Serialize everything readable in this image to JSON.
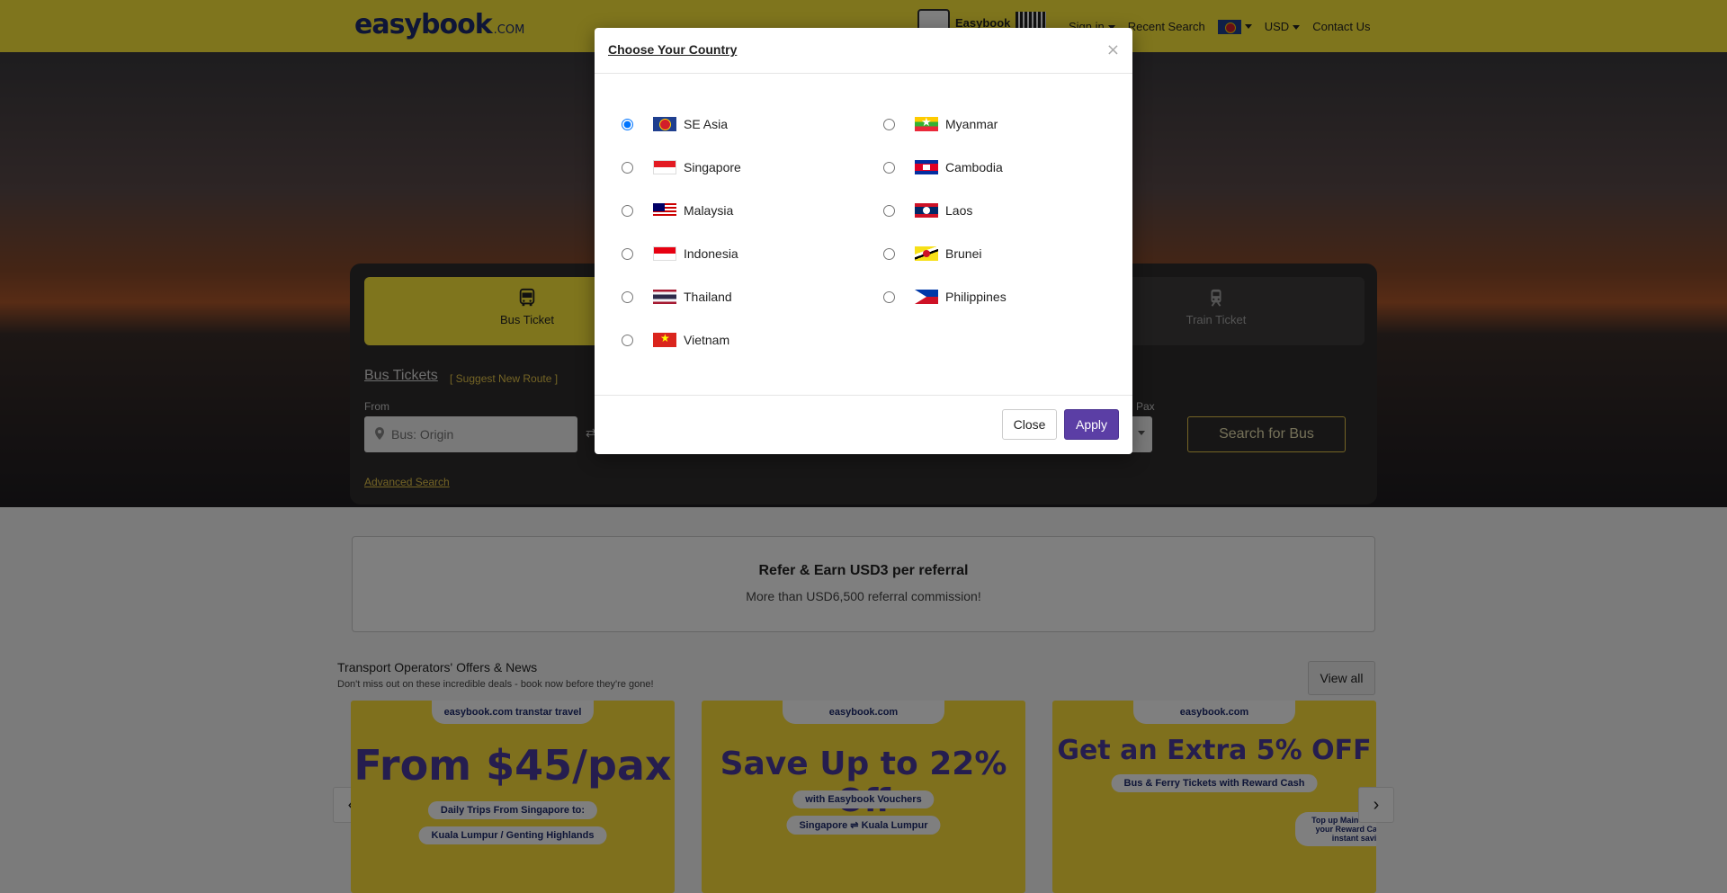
{
  "header": {
    "logo": "easybook",
    "logo_suffix": ".COM",
    "app_label": "Easybook",
    "nav": {
      "sign_in": "Sign in",
      "recent_search": "Recent Search",
      "currency": "USD",
      "contact": "Contact Us"
    }
  },
  "search": {
    "tabs": [
      {
        "label": "Bus Ticket",
        "icon": "bus-icon",
        "active": true
      },
      {
        "label": "Train Ticket",
        "icon": "train-icon",
        "active": false
      }
    ],
    "title": "Bus Tickets",
    "suggest": "[ Suggest New Route ]",
    "from_label": "From",
    "from_placeholder": "Bus: Origin",
    "pax_label": "Pax",
    "search_button": "Search for Bus",
    "advanced": "Advanced Search"
  },
  "referral": {
    "title": "Refer & Earn USD3 per referral",
    "subtitle": "More than USD6,500 referral commission!"
  },
  "offers": {
    "title": "Transport Operators' Offers & News",
    "subtitle": "Don't miss out on these incredible deals - book now before they're gone!",
    "view_all": "View all",
    "cards": [
      {
        "brand": "easybook.com  transtar travel",
        "headline": "From $45/pax",
        "sub": "Daily Trips From Singapore to:",
        "sub2": "Kuala Lumpur / Genting Highlands"
      },
      {
        "brand": "easybook.com",
        "headline": "Save Up to 22% Off",
        "sub": "with Easybook Vouchers",
        "sub2": "Singapore ⇌ Kuala Lumpur"
      },
      {
        "brand": "easybook.com",
        "headline": "Get an Extra 5% OFF",
        "sub": "Bus & Ferry Tickets with Reward Cash",
        "sub2": "Top up Main Cash, redeem your Reward Cash enjoy instant savings!"
      }
    ]
  },
  "modal": {
    "title": "Choose Your Country",
    "close_x": "×",
    "selected": "SE Asia",
    "left": [
      {
        "label": "SE Asia",
        "flag": "asean-flag-icon"
      },
      {
        "label": "Singapore",
        "flag": "singapore-flag-icon"
      },
      {
        "label": "Malaysia",
        "flag": "malaysia-flag-icon"
      },
      {
        "label": "Indonesia",
        "flag": "indonesia-flag-icon"
      },
      {
        "label": "Thailand",
        "flag": "thailand-flag-icon"
      },
      {
        "label": "Vietnam",
        "flag": "vietnam-flag-icon"
      }
    ],
    "right": [
      {
        "label": "Myanmar",
        "flag": "myanmar-flag-icon"
      },
      {
        "label": "Cambodia",
        "flag": "cambodia-flag-icon"
      },
      {
        "label": "Laos",
        "flag": "laos-flag-icon"
      },
      {
        "label": "Brunei",
        "flag": "brunei-flag-icon"
      },
      {
        "label": "Philippines",
        "flag": "philippines-flag-icon"
      }
    ],
    "close_button": "Close",
    "apply_button": "Apply"
  },
  "colors": {
    "header_bg": "#ffeb3b",
    "apply_bg": "#5b3ea5",
    "link": "#e8c84a"
  }
}
